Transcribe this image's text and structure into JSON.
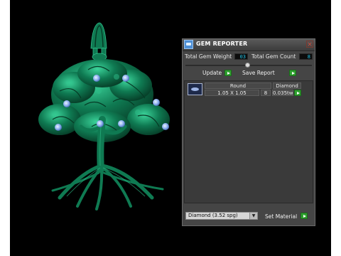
{
  "panel": {
    "title": "GEM REPORTER",
    "close_glyph": "×",
    "total_weight_label": "Total Gem Weight",
    "total_weight_value": "03",
    "total_count_label": "Total Gem Count",
    "total_count_value": "8",
    "update_label": "Update",
    "save_report_label": "Save Report",
    "table": {
      "headers": [
        "Round",
        "Diamond"
      ],
      "rows": [
        {
          "size": "1.05 X 1.05",
          "count": "8",
          "weight": "0.035tw"
        }
      ]
    },
    "material_select_value": "Diamond   (3.52 spg)",
    "set_material_label": "Set Material"
  },
  "colors": {
    "pendant": "#0f6b4a",
    "pendant_highlight": "#2fbf8a",
    "gem": "#8fb2f0",
    "panel_bg": "#454545",
    "digit_text": "#22c4e8",
    "play_button": "#2fa12f"
  },
  "icons": {
    "title": "gem-reporter-icon",
    "close": "close-icon",
    "play": "play-arrow-icon",
    "dropdown": "chevron-down-icon"
  }
}
